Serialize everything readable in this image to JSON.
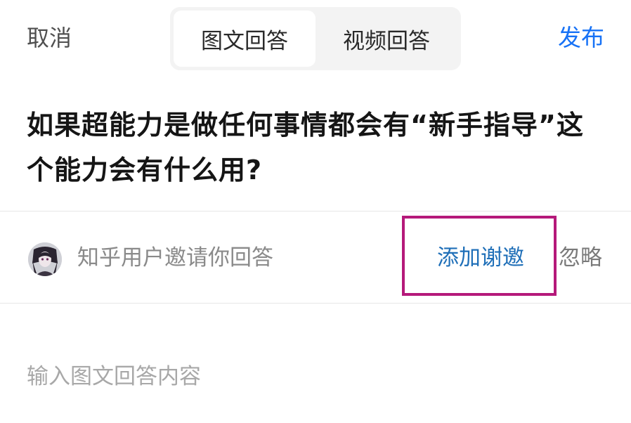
{
  "header": {
    "cancel_label": "取消",
    "tabs": [
      {
        "label": "图文回答",
        "selected": true
      },
      {
        "label": "视频回答",
        "selected": false
      }
    ],
    "publish_label": "发布",
    "publish_color": "#1772f6"
  },
  "question": {
    "title": "如果超能力是做任何事情都会有“新手指导”这个能力会有什么用?"
  },
  "invite": {
    "avatar_icon": "user-avatar",
    "text": "知乎用户邀请你回答",
    "thanks_label": "添加谢邀",
    "ignore_label": "忽略",
    "highlight_color": "#b5197a"
  },
  "editor": {
    "placeholder": "输入图文回答内容",
    "value": ""
  }
}
